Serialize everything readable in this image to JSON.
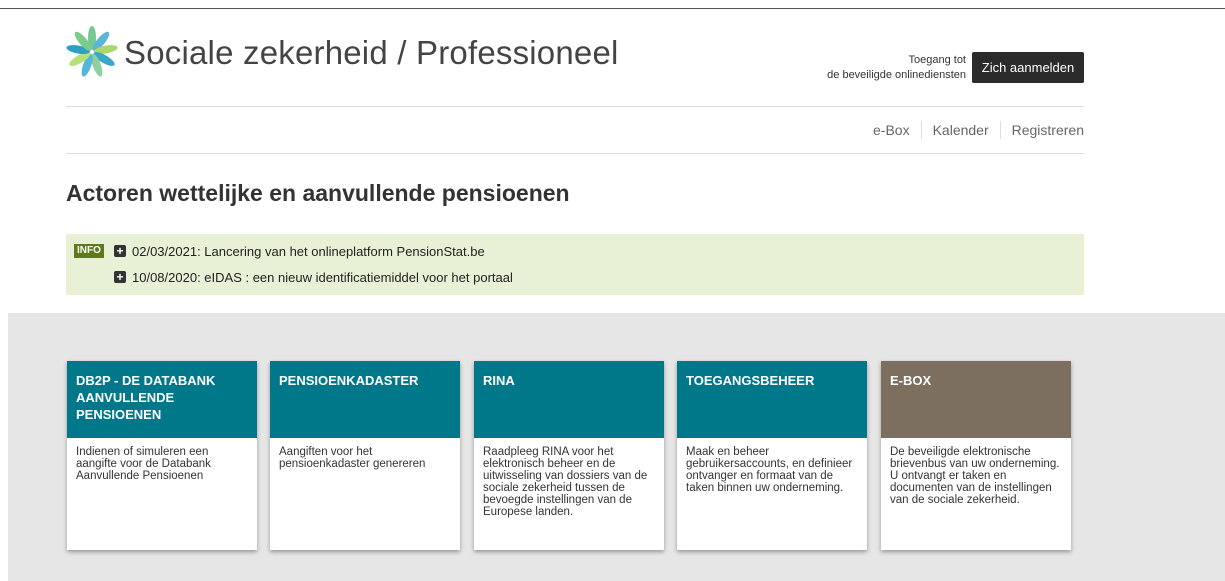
{
  "header": {
    "title": "Sociale zekerheid / Professioneel",
    "access_text_line1": "Toegang tot",
    "access_text_line2": "de beveiligde onlinediensten",
    "login_label": "Zich aanmelden"
  },
  "nav": {
    "items": [
      "e-Box",
      "Kalender",
      "Registreren"
    ]
  },
  "page": {
    "title": "Actoren wettelijke en aanvullende pensioenen"
  },
  "info": {
    "badge": "INFO",
    "items": [
      "02/03/2021: Lancering van het onlineplatform PensionStat.be",
      "10/08/2020: eIDAS : een nieuw identificatiemiddel voor het portaal"
    ]
  },
  "cards": [
    {
      "title": "DB2P - DE DATABANK AANVULLENDE PENSIOENEN",
      "description": "Indienen of simuleren een aangifte voor de Databank Aanvullende Pensioenen"
    },
    {
      "title": "PENSIOENKADASTER",
      "description": "Aangiften voor het pensioenkadaster genereren"
    },
    {
      "title": "RINA",
      "description": "Raadpleeg RINA voor het elektronisch beheer en de uitwisseling van dossiers van de sociale zekerheid tussen de bevoegde instellingen van de Europese landen."
    },
    {
      "title": "TOEGANGSBEHEER",
      "description": "Maak en beheer gebruikersaccounts, en definieer ontvanger en formaat van de taken binnen uw onderneming."
    },
    {
      "title": "E-BOX",
      "description": "De beveiligde elektronische brievenbus van uw onderneming. U ontvangt er taken en documenten van de instellingen van de sociale zekerheid."
    }
  ],
  "colors": {
    "card_teal": "#00788a",
    "card_brown": "#7c6f60",
    "info_bg": "#e8f1d5",
    "info_badge": "#5c7a1a",
    "login_button": "#2b2b2b"
  },
  "icons": {
    "logo": "leaf-logo-icon",
    "info_expand": "plus-square-icon"
  }
}
